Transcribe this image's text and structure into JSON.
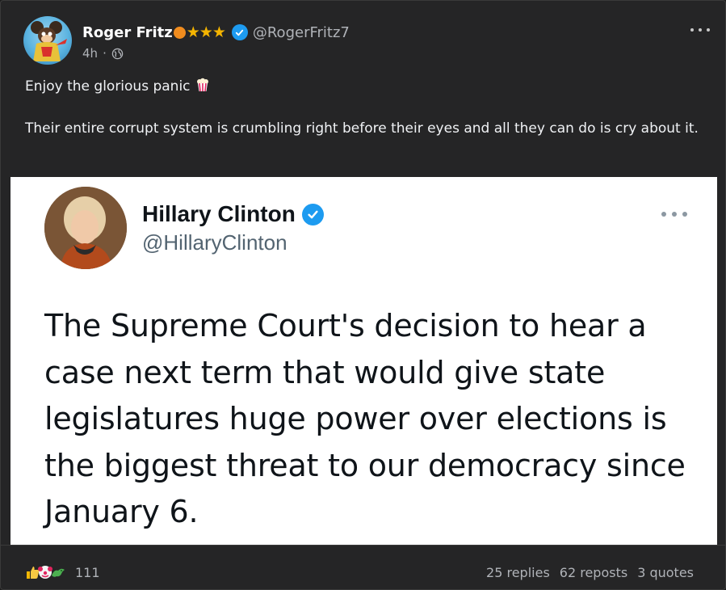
{
  "author": {
    "name": "Roger Fritz",
    "badges": "★★★",
    "handle": "@RogerFritz7",
    "time": "4h",
    "separator": "·"
  },
  "post": {
    "line1": "Enjoy the glorious panic",
    "line2": "Their entire corrupt system is crumbling right before their eyes and all they can do is cry about it."
  },
  "embed": {
    "name": "Hillary Clinton",
    "handle": "@HillaryClinton",
    "text": "The Supreme Court's decision to hear a case next term that would give state legislatures huge power over elections is the biggest threat to our democracy since January 6."
  },
  "footer": {
    "reaction_count": "111",
    "replies": "25 replies",
    "reposts": "62 reposts",
    "quotes": "3 quotes"
  },
  "colors": {
    "background": "#252526",
    "verified": "#1d9bf0",
    "star": "#f4b400"
  },
  "icons": [
    "avatar",
    "orange-emoji-icon",
    "verified-icon",
    "globe-icon",
    "more-options-icon",
    "popcorn-icon",
    "thumbs-up-icon",
    "clown-icon",
    "dragon-icon"
  ]
}
